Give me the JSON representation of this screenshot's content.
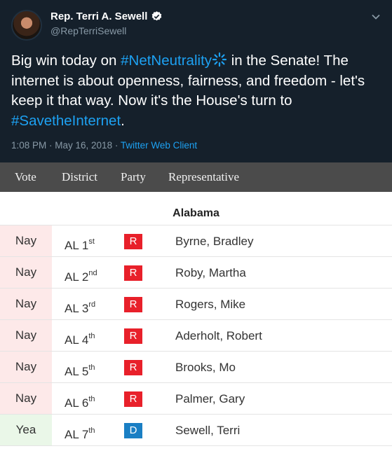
{
  "tweet": {
    "author_name": "Rep. Terri A. Sewell",
    "handle": "@RepTerriSewell",
    "text_1": "Big win today on ",
    "hashtag_1": "#NetNeutrality",
    "text_2": " in the Senate! The internet is about openness, fairness, and freedom - let's keep it that way. Now it's the House's turn to ",
    "hashtag_2": "#SavetheInternet",
    "text_3": ".",
    "timestamp": "1:08 PM · May 16, 2018 · ",
    "client": "Twitter Web Client",
    "icons": [
      "avatar",
      "verified-icon",
      "chevron-down-icon",
      "sparkle-icon"
    ],
    "colors": {
      "background": "#15202b",
      "link": "#1da1f2",
      "muted": "#8899a6"
    }
  },
  "table": {
    "headers": {
      "vote": "Vote",
      "district": "District",
      "party": "Party",
      "representative": "Representative"
    },
    "state": "Alabama",
    "rows": [
      {
        "vote": "Nay",
        "district": "AL 1",
        "ordinal": "st",
        "party": "R",
        "rep": "Byrne, Bradley"
      },
      {
        "vote": "Nay",
        "district": "AL 2",
        "ordinal": "nd",
        "party": "R",
        "rep": "Roby, Martha"
      },
      {
        "vote": "Nay",
        "district": "AL 3",
        "ordinal": "rd",
        "party": "R",
        "rep": "Rogers, Mike"
      },
      {
        "vote": "Nay",
        "district": "AL 4",
        "ordinal": "th",
        "party": "R",
        "rep": "Aderholt, Robert"
      },
      {
        "vote": "Nay",
        "district": "AL 5",
        "ordinal": "th",
        "party": "R",
        "rep": "Brooks, Mo"
      },
      {
        "vote": "Nay",
        "district": "AL 6",
        "ordinal": "th",
        "party": "R",
        "rep": "Palmer, Gary"
      },
      {
        "vote": "Yea",
        "district": "AL 7",
        "ordinal": "th",
        "party": "D",
        "rep": "Sewell, Terri"
      }
    ],
    "colors": {
      "republican": "#e8202a",
      "democrat": "#1a7fc4",
      "nay": "#fde9e9",
      "yea": "#eaf7e8"
    }
  }
}
